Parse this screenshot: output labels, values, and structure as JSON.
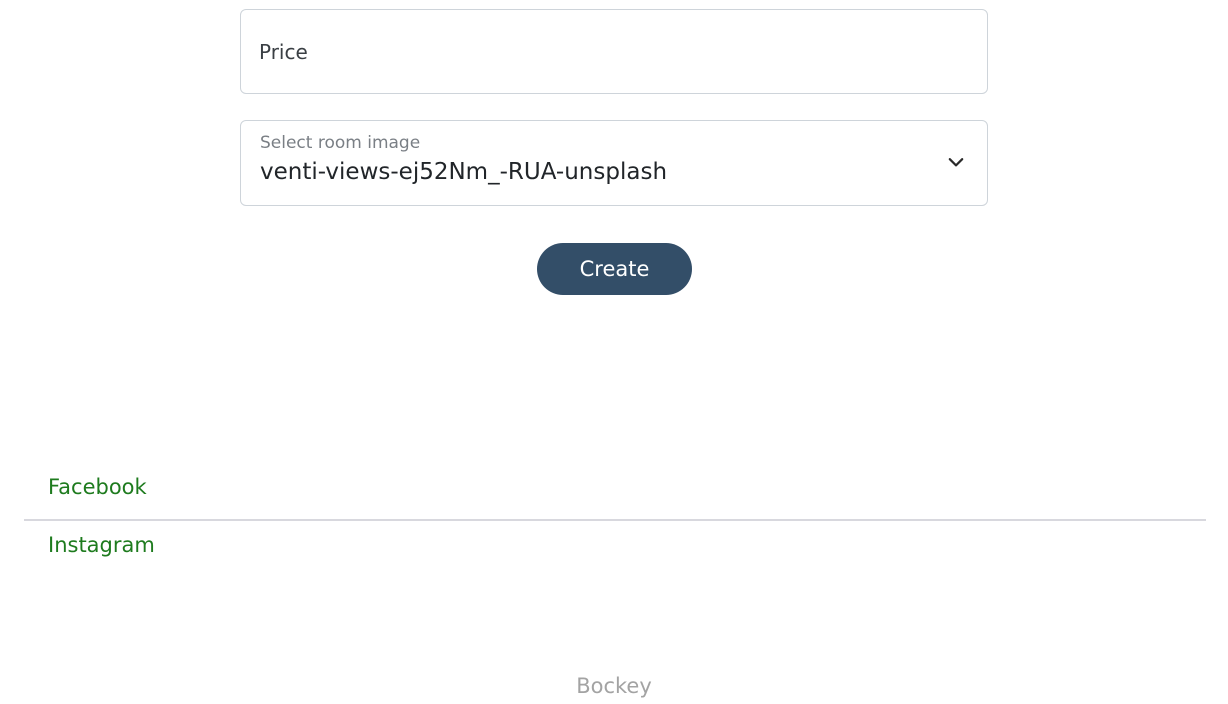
{
  "form": {
    "price_placeholder": "Price",
    "price_value": "",
    "image_select_label": "Select room image",
    "image_select_value": "venti-views-ej52Nm_-RUA-unsplash",
    "create_label": "Create"
  },
  "footer": {
    "links": [
      {
        "label": "Facebook",
        "icon": "",
        "color": "#1e7b1e"
      },
      {
        "label": "Instagram",
        "icon": "",
        "color": "#1e7b1e"
      }
    ],
    "brand": "Bockey"
  },
  "colors": {
    "button_bg": "#334e68",
    "link_color": "#1e7b1e",
    "brand_color": "#a3a3a3",
    "border_color": "#ced4da"
  },
  "icons": {
    "select_chevron": "chevron-down-icon"
  }
}
